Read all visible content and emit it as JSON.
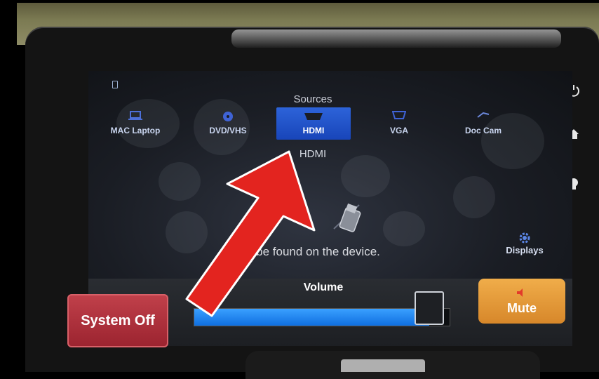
{
  "sources": {
    "title": "Sources",
    "items": [
      {
        "label": "MAC Laptop",
        "icon": "laptop-icon",
        "selected": false
      },
      {
        "label": "DVD/VHS",
        "icon": "disc-icon",
        "selected": false
      },
      {
        "label": "HDMI",
        "icon": "hdmi-icon",
        "selected": true
      },
      {
        "label": "VGA",
        "icon": "vga-icon",
        "selected": false
      },
      {
        "label": "Doc Cam",
        "icon": "document-camera-icon",
        "selected": false
      }
    ],
    "selected_label": "HDMI"
  },
  "info_text": "is can be found on the device.",
  "displays": {
    "label": "Displays",
    "icon": "gear-icon"
  },
  "controls": {
    "system_off_label": "System Off",
    "volume_label": "Volume",
    "volume_level": 0.92,
    "mute_label": "Mute",
    "mute_icon": "speaker-icon"
  },
  "hardware_buttons": [
    "power-icon",
    "home-icon",
    "light-bulb-icon"
  ],
  "colors": {
    "selected_source": "#1f4fc6",
    "volume_fill": "#1a7ff0",
    "system_off": "#b03340",
    "mute": "#e59a38",
    "annotation_arrow": "#e3241f"
  }
}
